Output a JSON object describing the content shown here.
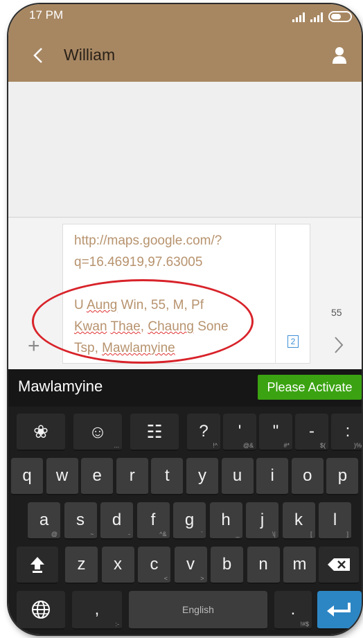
{
  "status_bar": {
    "time": "17 PM"
  },
  "header": {
    "contact_name": "William",
    "background": "#a78762"
  },
  "compose": {
    "lines": [
      "http://maps.google.com/?",
      "q=16.46919,97.63005",
      "",
      "U Aung Win, 55, M, Pf",
      "Kwan Thae, Chaung Sone",
      "Tsp, Mawlamyine"
    ],
    "sim_slot": "2",
    "char_count": "55"
  },
  "keyboard": {
    "suggestion": "Mawlamyine",
    "activate_label": "Please Activate",
    "row1": [
      {
        "label": "",
        "icon": "flower-icon",
        "sub": ""
      },
      {
        "label": "",
        "icon": "smiley-icon",
        "sub": "..."
      },
      {
        "label": "",
        "icon": "numpad-icon",
        "sub": ""
      },
      {
        "label": "?",
        "sub": "!^"
      },
      {
        "label": "'",
        "sub": "@&"
      },
      {
        "label": "\"",
        "sub": "#*"
      },
      {
        "label": "-",
        "sub": "$("
      },
      {
        "label": ":",
        "sub": ")%"
      }
    ],
    "row2": [
      {
        "label": "q",
        "sub": ""
      },
      {
        "label": "w",
        "sub": ""
      },
      {
        "label": "e",
        "sub": ""
      },
      {
        "label": "r",
        "sub": ""
      },
      {
        "label": "t",
        "sub": ""
      },
      {
        "label": "y",
        "sub": ""
      },
      {
        "label": "u",
        "sub": ""
      },
      {
        "label": "i",
        "sub": ""
      },
      {
        "label": "o",
        "sub": ""
      },
      {
        "label": "p",
        "sub": ""
      }
    ],
    "row3": [
      {
        "label": "a",
        "sub": "@"
      },
      {
        "label": "s",
        "sub": "~"
      },
      {
        "label": "d",
        "sub": "-"
      },
      {
        "label": "f",
        "sub": "^&"
      },
      {
        "label": "g",
        "sub": "`"
      },
      {
        "label": "h",
        "sub": "_"
      },
      {
        "label": "j",
        "sub": "\\|"
      },
      {
        "label": "k",
        "sub": "["
      },
      {
        "label": "l",
        "sub": "]"
      }
    ],
    "row4": [
      {
        "label": "z",
        "sub": ""
      },
      {
        "label": "x",
        "sub": ""
      },
      {
        "label": "c",
        "sub": "<"
      },
      {
        "label": "v",
        "sub": ">"
      },
      {
        "label": "b",
        "sub": ""
      },
      {
        "label": "n",
        "sub": ""
      },
      {
        "label": "m",
        "sub": ""
      }
    ],
    "row5": {
      "comma": ",",
      "comma_sub": ":-",
      "space": "English",
      "period": ".",
      "period_sub": "!#$"
    }
  }
}
